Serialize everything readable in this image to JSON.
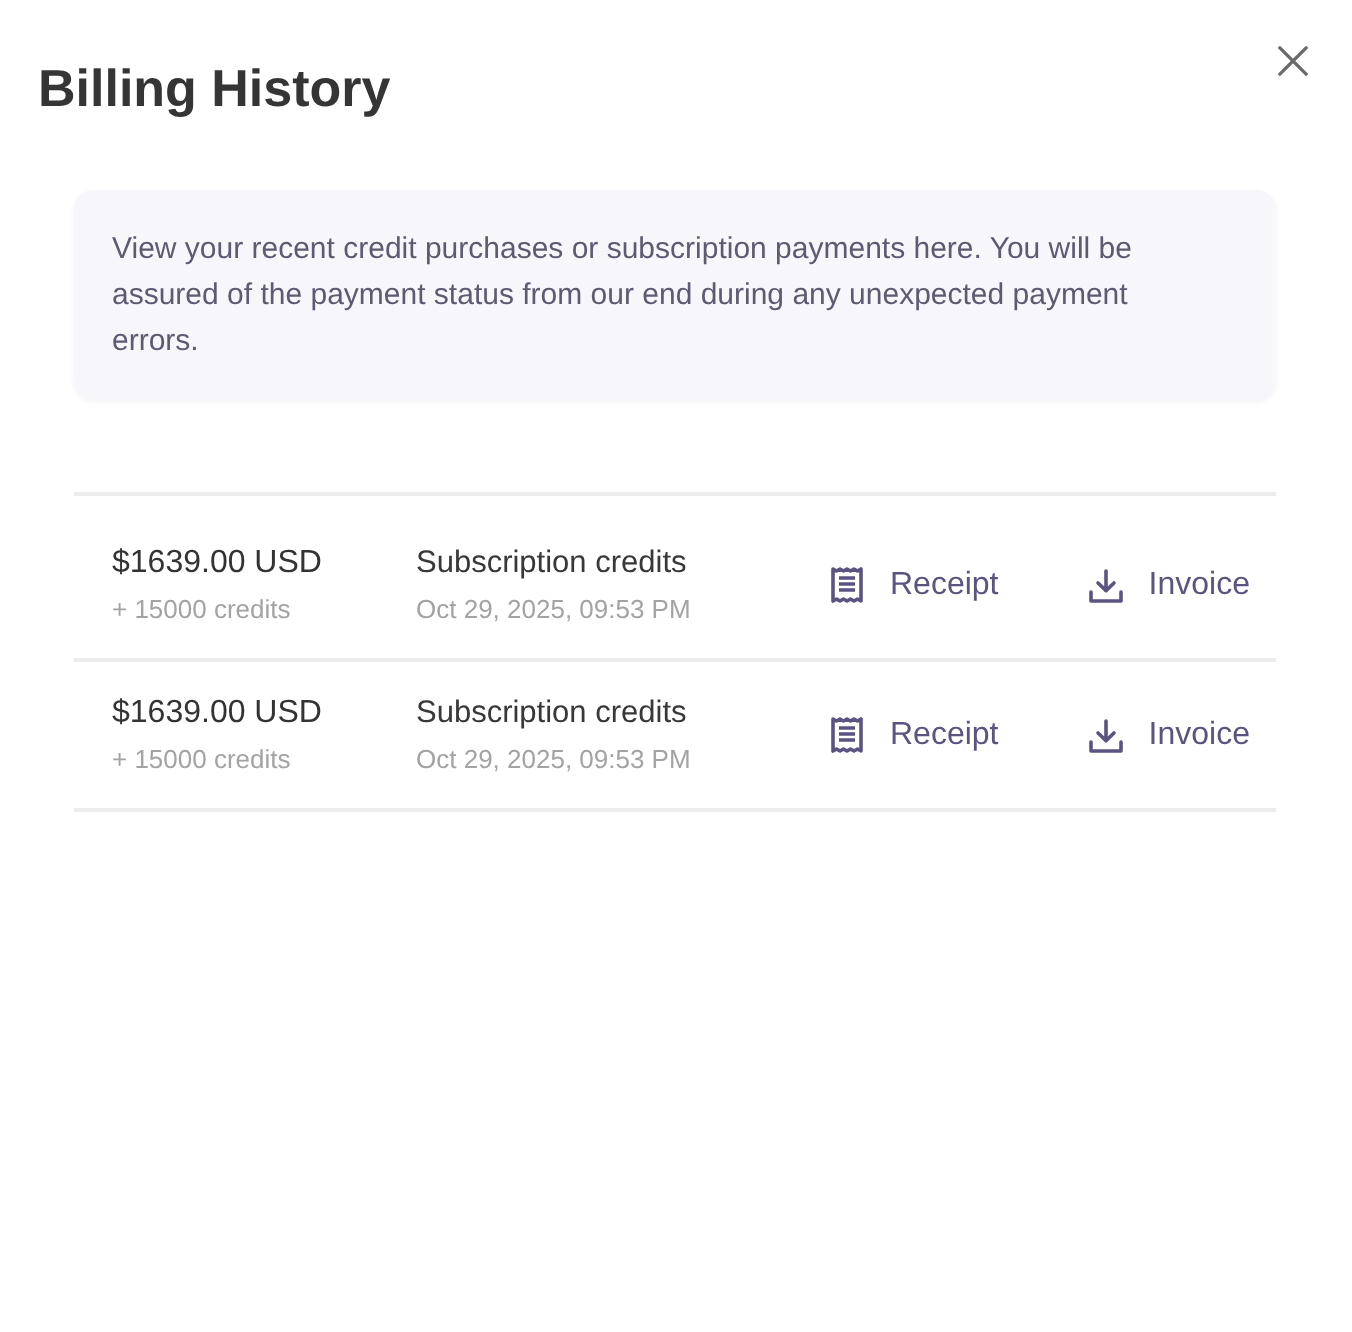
{
  "dialog": {
    "title": "Billing History",
    "info": "View your recent credit purchases or subscription payments here. You will be assured of the payment status from our end during any unexpected payment errors."
  },
  "transactions": [
    {
      "amount": "$1639.00 USD",
      "credits": "+ 15000 credits",
      "description": "Subscription credits",
      "date": "Oct 29, 2025, 09:53 PM",
      "actions": [
        {
          "kind": "receipt",
          "label": "Receipt"
        },
        {
          "kind": "download",
          "label": "Invoice"
        }
      ]
    },
    {
      "amount": "$1639.00 USD",
      "credits": "+ 15000 credits",
      "description": "Subscription credits",
      "date": "Oct 29, 2025, 09:53 PM",
      "actions": [
        {
          "kind": "receipt",
          "label": "Receipt"
        },
        {
          "kind": "download",
          "label": "Invoice"
        }
      ]
    }
  ]
}
